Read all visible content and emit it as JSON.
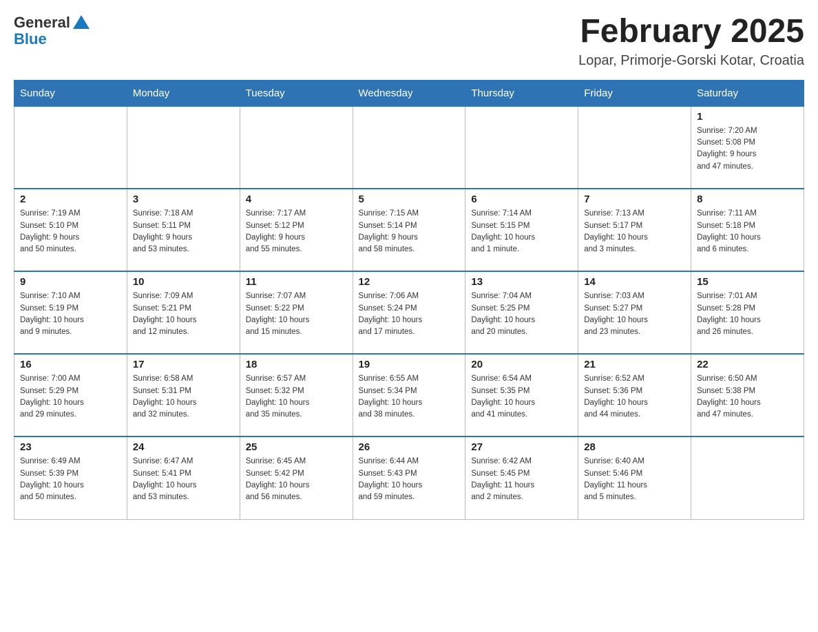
{
  "header": {
    "logo_general": "General",
    "logo_blue": "Blue",
    "month_title": "February 2025",
    "location": "Lopar, Primorje-Gorski Kotar, Croatia"
  },
  "days_of_week": [
    "Sunday",
    "Monday",
    "Tuesday",
    "Wednesday",
    "Thursday",
    "Friday",
    "Saturday"
  ],
  "weeks": [
    {
      "days": [
        {
          "num": "",
          "info": ""
        },
        {
          "num": "",
          "info": ""
        },
        {
          "num": "",
          "info": ""
        },
        {
          "num": "",
          "info": ""
        },
        {
          "num": "",
          "info": ""
        },
        {
          "num": "",
          "info": ""
        },
        {
          "num": "1",
          "info": "Sunrise: 7:20 AM\nSunset: 5:08 PM\nDaylight: 9 hours\nand 47 minutes."
        }
      ]
    },
    {
      "days": [
        {
          "num": "2",
          "info": "Sunrise: 7:19 AM\nSunset: 5:10 PM\nDaylight: 9 hours\nand 50 minutes."
        },
        {
          "num": "3",
          "info": "Sunrise: 7:18 AM\nSunset: 5:11 PM\nDaylight: 9 hours\nand 53 minutes."
        },
        {
          "num": "4",
          "info": "Sunrise: 7:17 AM\nSunset: 5:12 PM\nDaylight: 9 hours\nand 55 minutes."
        },
        {
          "num": "5",
          "info": "Sunrise: 7:15 AM\nSunset: 5:14 PM\nDaylight: 9 hours\nand 58 minutes."
        },
        {
          "num": "6",
          "info": "Sunrise: 7:14 AM\nSunset: 5:15 PM\nDaylight: 10 hours\nand 1 minute."
        },
        {
          "num": "7",
          "info": "Sunrise: 7:13 AM\nSunset: 5:17 PM\nDaylight: 10 hours\nand 3 minutes."
        },
        {
          "num": "8",
          "info": "Sunrise: 7:11 AM\nSunset: 5:18 PM\nDaylight: 10 hours\nand 6 minutes."
        }
      ]
    },
    {
      "days": [
        {
          "num": "9",
          "info": "Sunrise: 7:10 AM\nSunset: 5:19 PM\nDaylight: 10 hours\nand 9 minutes."
        },
        {
          "num": "10",
          "info": "Sunrise: 7:09 AM\nSunset: 5:21 PM\nDaylight: 10 hours\nand 12 minutes."
        },
        {
          "num": "11",
          "info": "Sunrise: 7:07 AM\nSunset: 5:22 PM\nDaylight: 10 hours\nand 15 minutes."
        },
        {
          "num": "12",
          "info": "Sunrise: 7:06 AM\nSunset: 5:24 PM\nDaylight: 10 hours\nand 17 minutes."
        },
        {
          "num": "13",
          "info": "Sunrise: 7:04 AM\nSunset: 5:25 PM\nDaylight: 10 hours\nand 20 minutes."
        },
        {
          "num": "14",
          "info": "Sunrise: 7:03 AM\nSunset: 5:27 PM\nDaylight: 10 hours\nand 23 minutes."
        },
        {
          "num": "15",
          "info": "Sunrise: 7:01 AM\nSunset: 5:28 PM\nDaylight: 10 hours\nand 26 minutes."
        }
      ]
    },
    {
      "days": [
        {
          "num": "16",
          "info": "Sunrise: 7:00 AM\nSunset: 5:29 PM\nDaylight: 10 hours\nand 29 minutes."
        },
        {
          "num": "17",
          "info": "Sunrise: 6:58 AM\nSunset: 5:31 PM\nDaylight: 10 hours\nand 32 minutes."
        },
        {
          "num": "18",
          "info": "Sunrise: 6:57 AM\nSunset: 5:32 PM\nDaylight: 10 hours\nand 35 minutes."
        },
        {
          "num": "19",
          "info": "Sunrise: 6:55 AM\nSunset: 5:34 PM\nDaylight: 10 hours\nand 38 minutes."
        },
        {
          "num": "20",
          "info": "Sunrise: 6:54 AM\nSunset: 5:35 PM\nDaylight: 10 hours\nand 41 minutes."
        },
        {
          "num": "21",
          "info": "Sunrise: 6:52 AM\nSunset: 5:36 PM\nDaylight: 10 hours\nand 44 minutes."
        },
        {
          "num": "22",
          "info": "Sunrise: 6:50 AM\nSunset: 5:38 PM\nDaylight: 10 hours\nand 47 minutes."
        }
      ]
    },
    {
      "days": [
        {
          "num": "23",
          "info": "Sunrise: 6:49 AM\nSunset: 5:39 PM\nDaylight: 10 hours\nand 50 minutes."
        },
        {
          "num": "24",
          "info": "Sunrise: 6:47 AM\nSunset: 5:41 PM\nDaylight: 10 hours\nand 53 minutes."
        },
        {
          "num": "25",
          "info": "Sunrise: 6:45 AM\nSunset: 5:42 PM\nDaylight: 10 hours\nand 56 minutes."
        },
        {
          "num": "26",
          "info": "Sunrise: 6:44 AM\nSunset: 5:43 PM\nDaylight: 10 hours\nand 59 minutes."
        },
        {
          "num": "27",
          "info": "Sunrise: 6:42 AM\nSunset: 5:45 PM\nDaylight: 11 hours\nand 2 minutes."
        },
        {
          "num": "28",
          "info": "Sunrise: 6:40 AM\nSunset: 5:46 PM\nDaylight: 11 hours\nand 5 minutes."
        },
        {
          "num": "",
          "info": ""
        }
      ]
    }
  ]
}
